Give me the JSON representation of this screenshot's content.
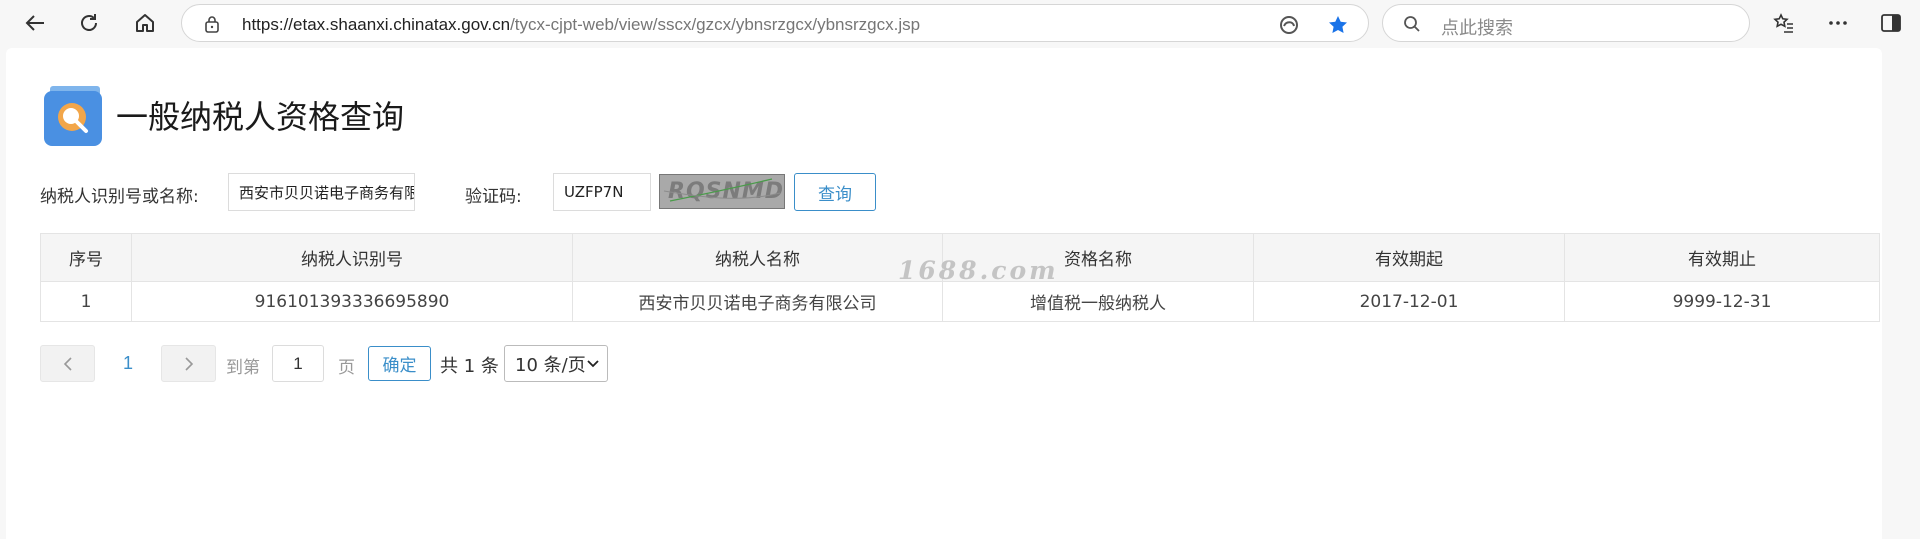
{
  "browser": {
    "url_domain": "https://etax.shaanxi.chinatax.gov.cn",
    "url_path": "/tycx-cjpt-web/view/sscx/gzcx/ybnsrzgcx/ybnsrzgcx.jsp",
    "search_placeholder": "点此搜索",
    "icons": [
      "back-icon",
      "refresh-icon",
      "home-icon",
      "lock-icon",
      "edge-icon",
      "star-icon",
      "search-icon",
      "favorites-icon",
      "more-icon",
      "sidebar-icon"
    ]
  },
  "page": {
    "title": "一般纳税人资格查询",
    "taxpayer_label": "纳税人识别号或名称:",
    "taxpayer_value": "西安市贝贝诺电子商务有限公司",
    "captcha_label": "验证码:",
    "captcha_value": "UZFP7N",
    "captcha_image_text": "RQSNMD",
    "query_button": "查询"
  },
  "table": {
    "headers": [
      "序号",
      "纳税人识别号",
      "纳税人名称",
      "资格名称",
      "有效期起",
      "有效期止"
    ],
    "rows": [
      [
        "1",
        "916101393336695890",
        "西安市贝贝诺电子商务有限公司",
        "增值税一般纳税人",
        "2017-12-01",
        "9999-12-31"
      ]
    ]
  },
  "watermark": "1688.com",
  "pagination": {
    "current_page": "1",
    "goto_label": "到第",
    "goto_value": "1",
    "page_unit": "页",
    "confirm": "确定",
    "total": "共 1 条",
    "page_size": "10 条/页"
  },
  "colors": {
    "accent": "#3a8ec9",
    "star": "#1a73e8"
  }
}
